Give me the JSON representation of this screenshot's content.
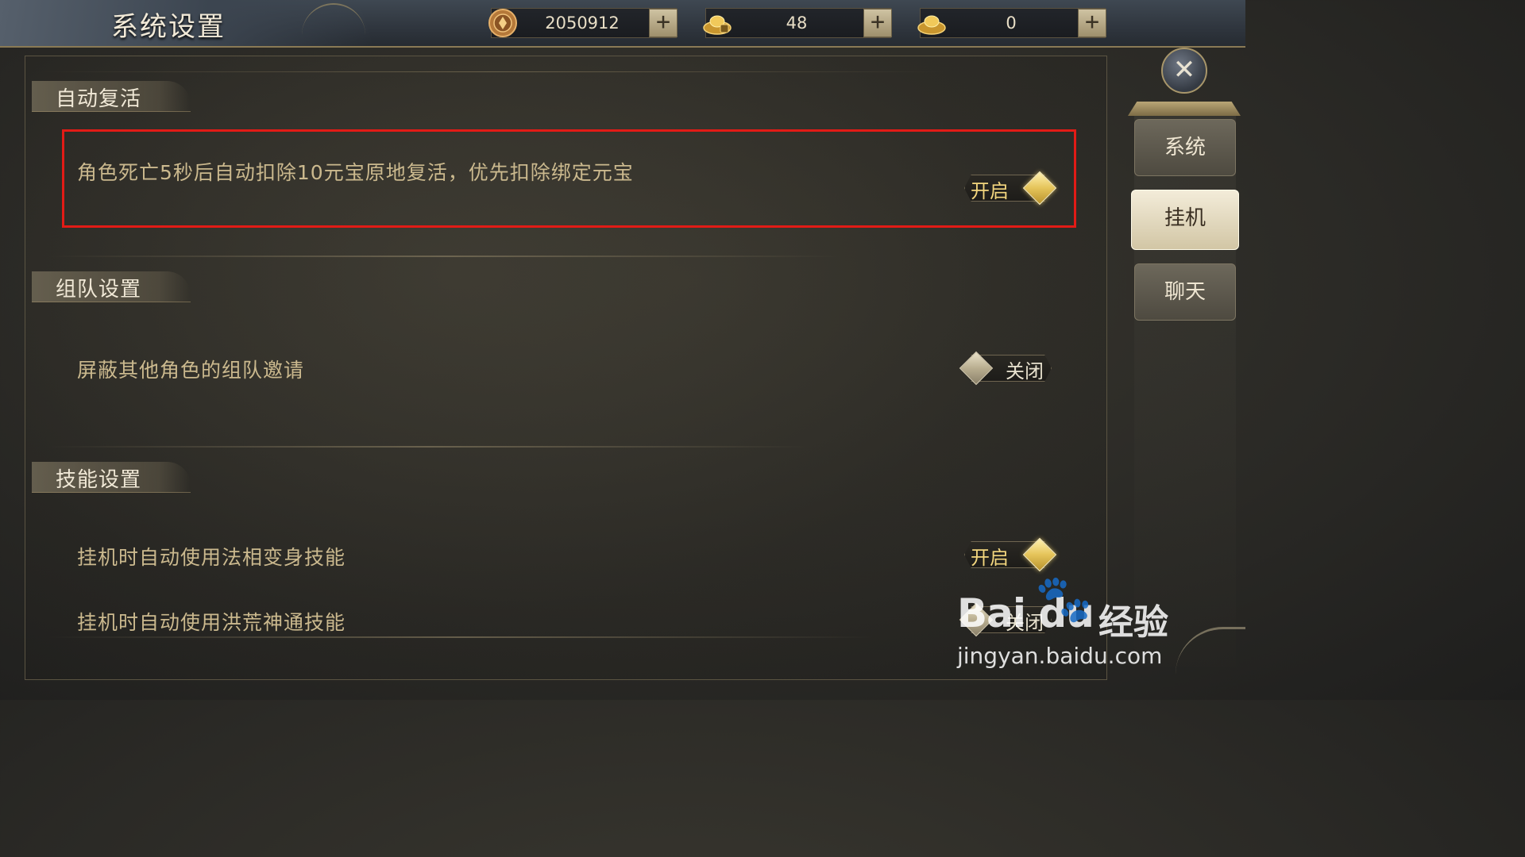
{
  "header": {
    "title": "系统设置",
    "currencies": [
      {
        "icon": "copper-coin-icon",
        "value": "2050912"
      },
      {
        "icon": "bound-gold-ingot-icon",
        "value": "48"
      },
      {
        "icon": "gold-ingot-icon",
        "value": "0"
      }
    ],
    "plus_label": "+"
  },
  "sections": {
    "revive": {
      "title": "自动复活",
      "option": "角色死亡5秒后自动扣除10元宝原地复活，优先扣除绑定元宝",
      "toggle": "开启"
    },
    "team": {
      "title": "组队设置",
      "option": "屏蔽其他角色的组队邀请",
      "toggle": "关闭"
    },
    "skill": {
      "title": "技能设置",
      "option1": "挂机时自动使用法相变身技能",
      "toggle1": "开启",
      "option2": "挂机时自动使用洪荒神通技能",
      "toggle2": "关闭"
    }
  },
  "side_nav": {
    "close": "✕",
    "tabs": [
      "系统",
      "挂机",
      "聊天"
    ],
    "active_tab": "挂机"
  },
  "watermark": {
    "logo": "Bai du",
    "text": "经验",
    "url": "jingyan.baidu.com"
  },
  "colors": {
    "highlight": "#e21b16",
    "toggle_on": "#f3d67e",
    "text": "#cbb98e"
  }
}
